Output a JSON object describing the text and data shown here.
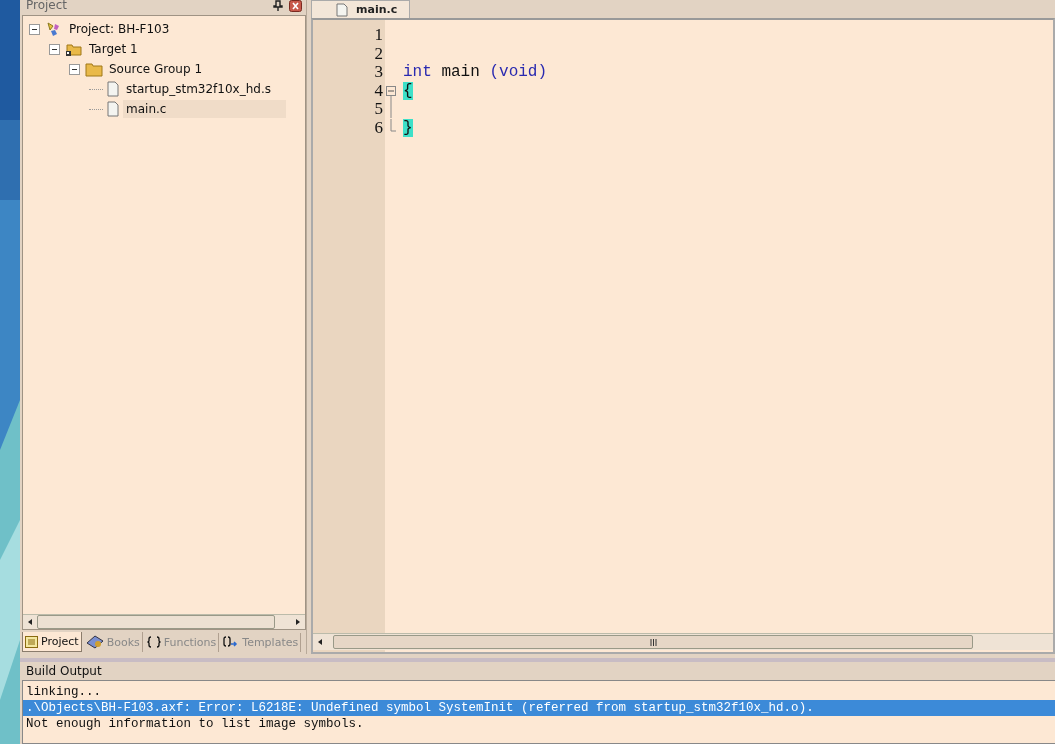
{
  "project_panel": {
    "title": "Project",
    "tree": [
      {
        "label": "Project: BH-F103",
        "kind": "project",
        "expanded": true,
        "selected": false,
        "children": [
          {
            "label": "Target 1",
            "kind": "target",
            "expanded": true,
            "selected": false,
            "children": [
              {
                "label": "Source Group 1",
                "kind": "folder",
                "expanded": true,
                "selected": false,
                "children": [
                  {
                    "label": "startup_stm32f10x_hd.s",
                    "kind": "file",
                    "selected": false
                  },
                  {
                    "label": "main.c",
                    "kind": "file",
                    "selected": true
                  }
                ]
              }
            ]
          }
        ]
      }
    ],
    "tabs": [
      {
        "label": "Project",
        "kind": "project",
        "selected": true
      },
      {
        "label": "Books",
        "kind": "books",
        "selected": false
      },
      {
        "label": "Functions",
        "kind": "functions",
        "selected": false
      },
      {
        "label": "Templates",
        "kind": "templates",
        "selected": false
      }
    ]
  },
  "editor": {
    "tabs": [
      {
        "label": "main.c",
        "selected": true
      }
    ],
    "lines": [
      {
        "number": "1",
        "kind": "plain"
      },
      {
        "number": "2",
        "kind": "plain"
      },
      {
        "number": "3",
        "kind": "plain",
        "tokens": [
          {
            "text": "int",
            "kind": "keyword"
          },
          {
            "text": " main ",
            "kind": "plain"
          },
          {
            "text": "(void)",
            "kind": "keyword"
          }
        ]
      },
      {
        "number": "4",
        "kind": "fold-start",
        "folded": false,
        "tokens": [
          {
            "text": "{",
            "kind": "brace-match"
          }
        ]
      },
      {
        "number": "5",
        "kind": "fold-inside"
      },
      {
        "number": "6",
        "kind": "fold-end",
        "tokens": [
          {
            "text": "}",
            "kind": "brace-match"
          }
        ]
      }
    ]
  },
  "build_output": {
    "title": "Build Output",
    "lines": [
      {
        "text": "linking...",
        "selected": false
      },
      {
        "text": ".\\Objects\\BH-F103.axf: Error: L6218E: Undefined symbol SystemInit (referred from startup_stm32f10x_hd.o).",
        "selected": true
      },
      {
        "text": "Not enough information to list image symbols.",
        "selected": false
      }
    ]
  }
}
